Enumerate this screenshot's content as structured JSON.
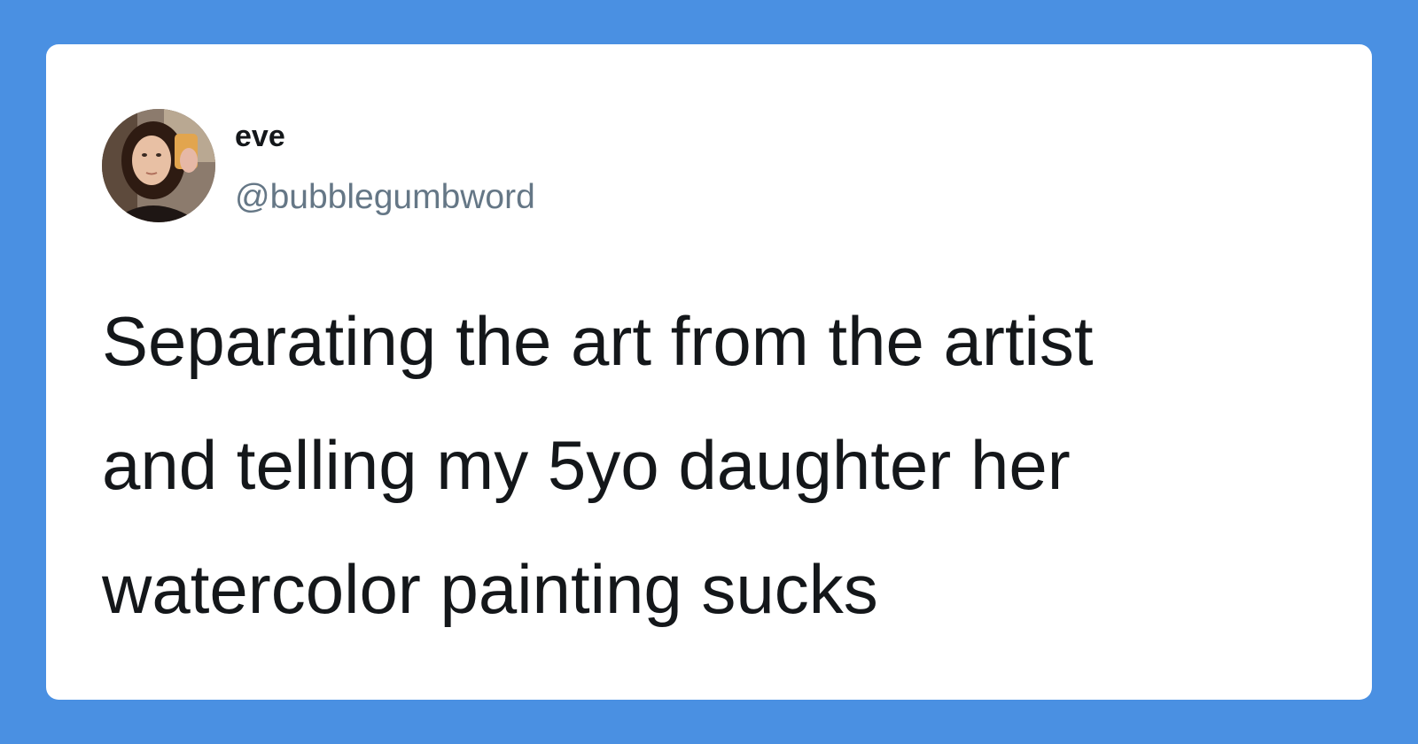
{
  "background_color": "#4a90e2",
  "card_color": "#ffffff",
  "author": {
    "display_name": "eve",
    "handle": "@bubblegumbword",
    "avatar_icon": "avatar-photo"
  },
  "tweet": {
    "lines": [
      "Separating the art from the artist",
      "and telling my 5yo daughter her",
      "watercolor painting sucks"
    ]
  }
}
